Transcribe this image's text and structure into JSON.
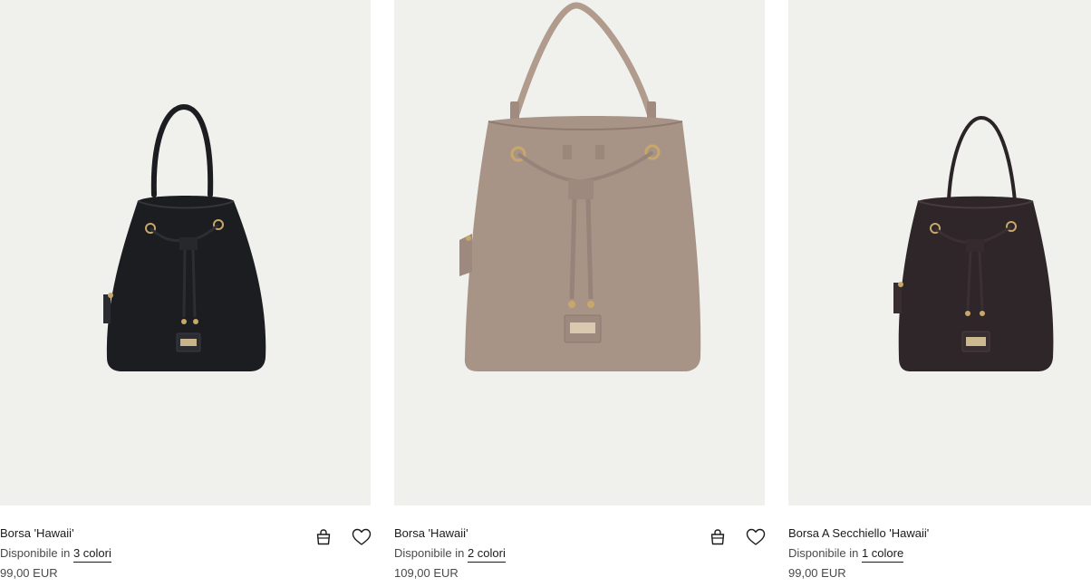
{
  "products": [
    {
      "name": "Borsa 'Hawaii'",
      "availability_prefix": "Disponibile in",
      "availability_link": "3 colori",
      "price": "99,00 EUR",
      "color": "#1c1d21",
      "image_icon": "black-bucket-bag-image",
      "has_actions": true
    },
    {
      "name": "Borsa 'Hawaii'",
      "availability_prefix": "Disponibile in",
      "availability_link": "2 colori",
      "price": "109,00 EUR",
      "color": "#a89487",
      "image_icon": "taupe-bucket-bag-image",
      "has_actions": true
    },
    {
      "name": "Borsa A Secchiello 'Hawaii'",
      "availability_prefix": "Disponibile in",
      "availability_link": "1 colore",
      "price": "99,00 EUR",
      "color": "#2f2629",
      "image_icon": "dark-brown-bucket-bag-image",
      "has_actions": false
    }
  ],
  "icons": {
    "add_to_bag": "shopping-bag-icon",
    "wishlist": "heart-icon"
  },
  "colors": {
    "image_background": "#f0f0ed",
    "text": "#1a1a1a",
    "muted_text": "#4a4a4a"
  }
}
